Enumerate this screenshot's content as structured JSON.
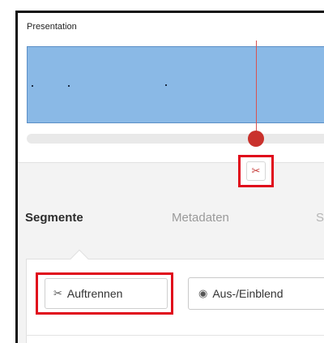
{
  "track": {
    "title": "Presentation"
  },
  "cut_button": {
    "icon": "scissors-icon"
  },
  "tabs": [
    {
      "label": "Segmente",
      "active": true
    },
    {
      "label": "Metadaten",
      "active": false
    },
    {
      "label": "S",
      "active": false
    }
  ],
  "toolbar": {
    "split_label": "Auftrennen",
    "split_icon": "scissors-icon",
    "toggle_label": "Aus-/Einblend",
    "toggle_icon": "eye-slash-icon"
  },
  "colors": {
    "waveform": "#8ab9e6",
    "playhead": "#c9312c",
    "highlight": "#e0091b"
  }
}
